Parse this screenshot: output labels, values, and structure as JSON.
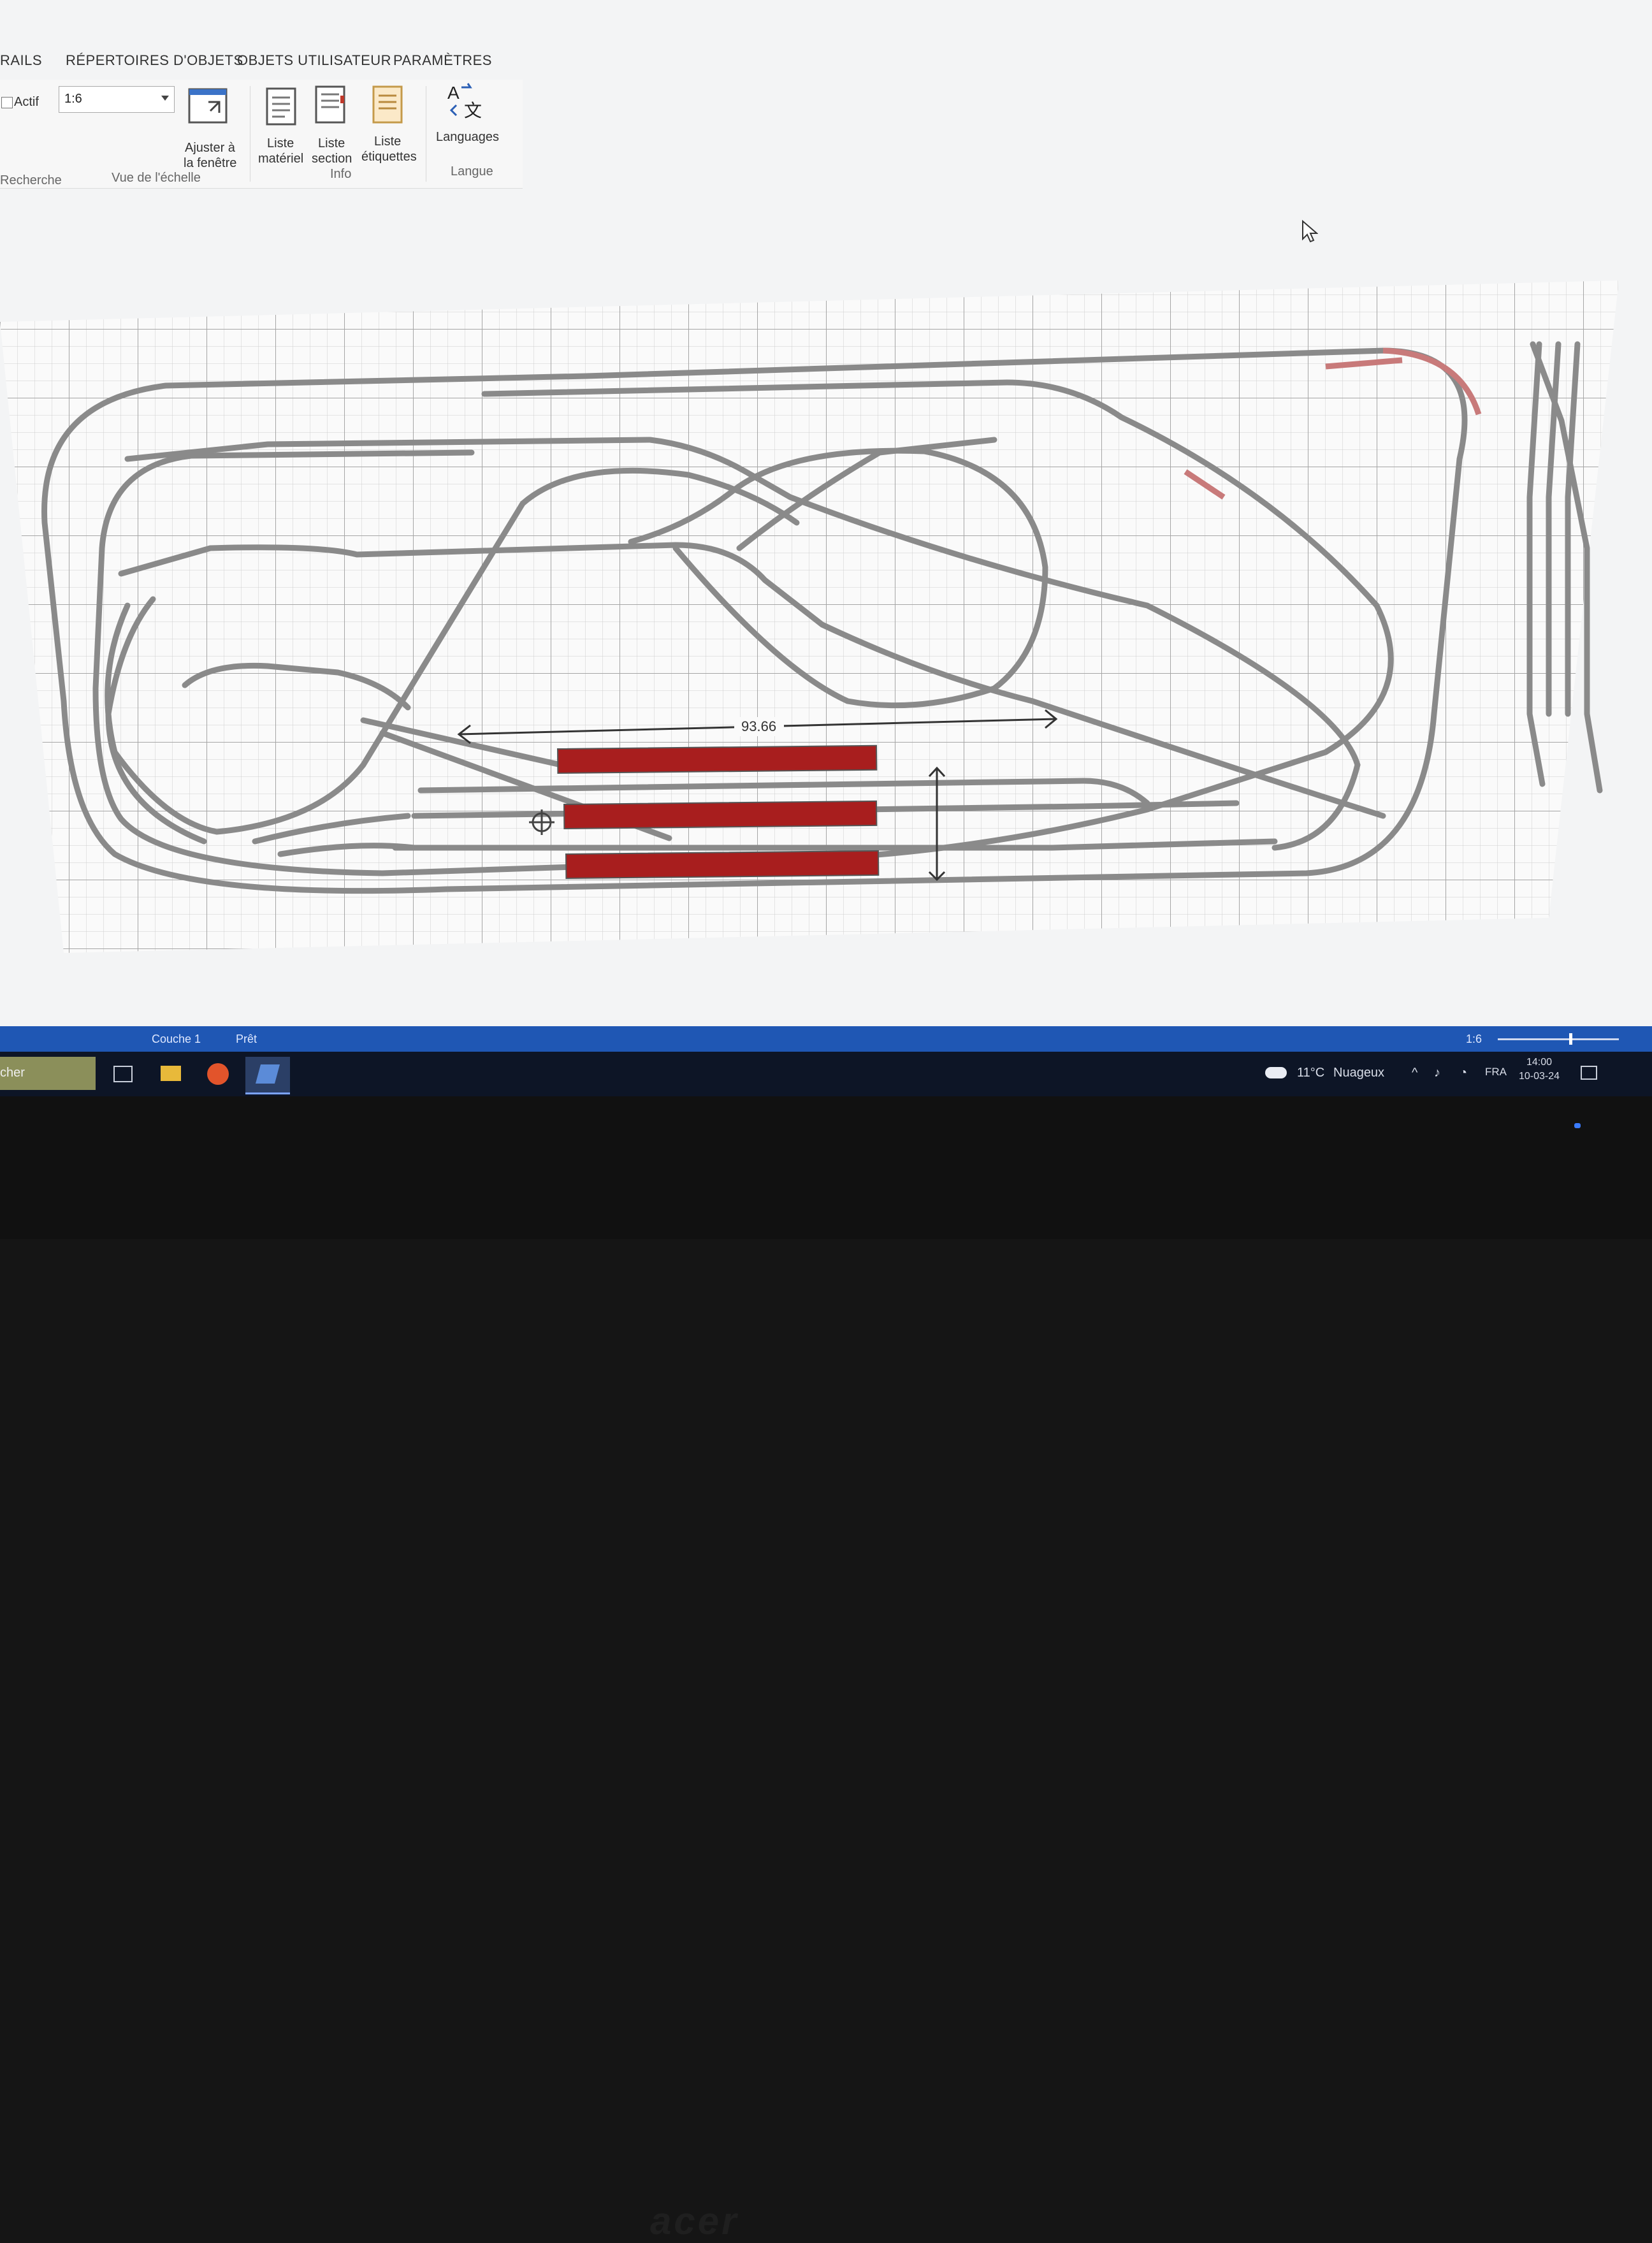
{
  "ribbon": {
    "tabs": [
      "RAILS",
      "RÉPERTOIRES D'OBJETS",
      "OBJETS UTILISATEUR",
      "PARAMÈTRES"
    ],
    "search_checkbox_label": "Actif",
    "scale_value": "1:6",
    "fit_window_label_1": "Ajuster à",
    "fit_window_label_2": "la fenêtre",
    "list_material_1": "Liste",
    "list_material_2": "matériel",
    "list_section_1": "Liste",
    "list_section_2": "section",
    "list_labels_1": "Liste",
    "list_labels_2": "étiquettes",
    "languages_label": "Languages",
    "group_search": "Recherche",
    "group_scale": "Vue de l'échelle",
    "group_info": "Info",
    "group_language": "Langue"
  },
  "drawing": {
    "dimension_label": "93.66"
  },
  "statusbar": {
    "layer": "Couche 1",
    "state": "Prêt",
    "zoom": "1:6"
  },
  "taskbar": {
    "search_fragment": "cher",
    "weather_temp": "11°C",
    "weather_desc": "Nuageux",
    "language": "FRA",
    "time": "14:00",
    "date": "10-03-24"
  },
  "monitor": {
    "brand": "acer"
  },
  "colors": {
    "ribbon_bg": "#f7f7f7",
    "statusbar": "#1f57b4",
    "track": "#8a8a8a",
    "red_block": "#a81e1e"
  }
}
